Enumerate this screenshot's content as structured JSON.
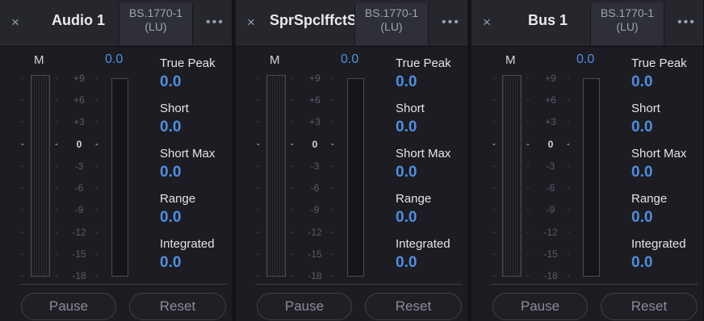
{
  "panels": [
    {
      "close_icon": "×",
      "title": "Audio 1",
      "standard": [
        "BS.1770-1",
        "(LU)"
      ],
      "more_icon": "•••",
      "meter_label": "M",
      "meter_value": "0.0",
      "scale": [
        "+9",
        "+6",
        "+3",
        "0",
        "-3",
        "-6",
        "-9",
        "-12",
        "-15",
        "-18"
      ],
      "stats": [
        {
          "label": "True Peak",
          "value": "0.0"
        },
        {
          "label": "Short",
          "value": "0.0"
        },
        {
          "label": "Short Max",
          "value": "0.0"
        },
        {
          "label": "Range",
          "value": "0.0"
        },
        {
          "label": "Integrated",
          "value": "0.0"
        }
      ],
      "pause_label": "Pause",
      "reset_label": "Reset"
    },
    {
      "close_icon": "×",
      "title": "SprSpclffctS",
      "standard": [
        "BS.1770-1",
        "(LU)"
      ],
      "more_icon": "•••",
      "meter_label": "M",
      "meter_value": "0.0",
      "scale": [
        "+9",
        "+6",
        "+3",
        "0",
        "-3",
        "-6",
        "-9",
        "-12",
        "-15",
        "-18"
      ],
      "stats": [
        {
          "label": "True Peak",
          "value": "0.0"
        },
        {
          "label": "Short",
          "value": "0.0"
        },
        {
          "label": "Short Max",
          "value": "0.0"
        },
        {
          "label": "Range",
          "value": "0.0"
        },
        {
          "label": "Integrated",
          "value": "0.0"
        }
      ],
      "pause_label": "Pause",
      "reset_label": "Reset"
    },
    {
      "close_icon": "×",
      "title": "Bus 1",
      "standard": [
        "BS.1770-1",
        "(LU)"
      ],
      "more_icon": "•••",
      "meter_label": "M",
      "meter_value": "0.0",
      "scale": [
        "+9",
        "+6",
        "+3",
        "0",
        "-3",
        "-6",
        "-9",
        "-12",
        "-15",
        "-18"
      ],
      "stats": [
        {
          "label": "True Peak",
          "value": "0.0"
        },
        {
          "label": "Short",
          "value": "0.0"
        },
        {
          "label": "Short Max",
          "value": "0.0"
        },
        {
          "label": "Range",
          "value": "0.0"
        },
        {
          "label": "Integrated",
          "value": "0.0"
        }
      ],
      "pause_label": "Pause",
      "reset_label": "Reset"
    }
  ],
  "colors": {
    "accent_value": "#4d8fe0",
    "panel_bg": "#1c1c22",
    "header_bg": "#26262d"
  },
  "icons": {
    "close": "close-icon",
    "more": "more-options-icon"
  }
}
